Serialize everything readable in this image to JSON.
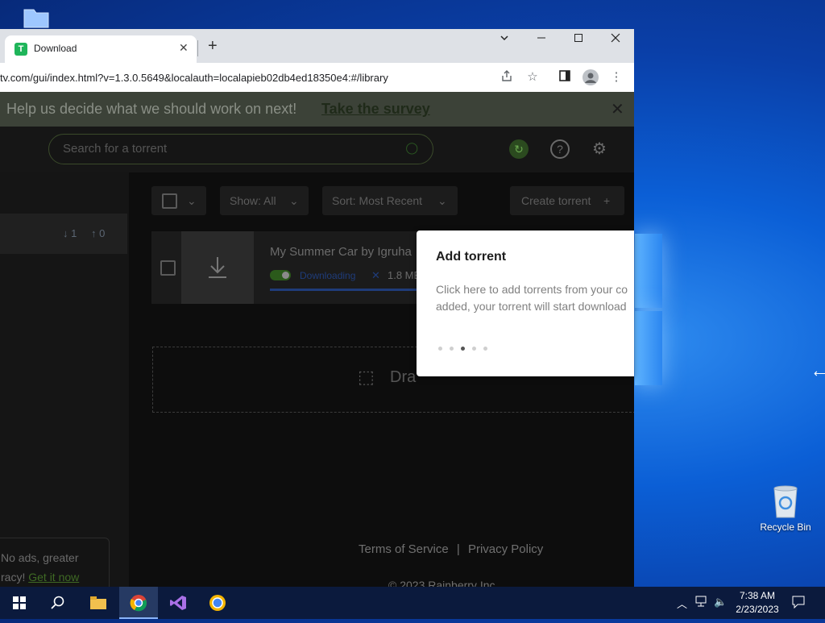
{
  "browser": {
    "tab_title": "Download",
    "tab_favicon": "T",
    "tab_close": "✕",
    "new_tab": "+",
    "url": "tv.com/gui/index.html?v=1.3.0.5649&localauth=localapieb02db4ed18350e4:#/library",
    "window_controls": [
      "chevron-down",
      "minimize",
      "maximize",
      "close"
    ]
  },
  "survey": {
    "message": "Help us decide what we should work on next!",
    "link": "Take the survey",
    "close": "✕"
  },
  "header": {
    "search_placeholder": "Search for a torrent"
  },
  "sidebar": {
    "count_a": "1",
    "count_b": "0",
    "promo_line1": "No ads, greater",
    "promo_line2_prefix": "racy!",
    "promo_link": "Get it now"
  },
  "controls": {
    "show_label": "Show:",
    "show_value": "All",
    "sort_label": "Sort:",
    "sort_value": "Most Recent",
    "create_label": "Create torrent",
    "create_icon": "+"
  },
  "torrent": {
    "name": "My Summer Car by Igruha",
    "status": "Downloading",
    "size": "1.8 MB",
    "progress": 1.0
  },
  "dropzone": {
    "text": "Dra"
  },
  "footer": {
    "terms": "Terms of Service",
    "separator": "|",
    "privacy": "Privacy Policy",
    "copyright": "© 2023 Rainberry Inc."
  },
  "popup": {
    "title": "Add torrent",
    "body_line1": "Click here to add torrents from your co",
    "body_line2": "added, your torrent will start download",
    "steps_total": 5,
    "steps_active": 3
  },
  "desktop": {
    "recycle_bin": "Recycle Bin"
  },
  "taskbar": {
    "time": "7:38 AM",
    "date": "2/23/2023"
  },
  "colors": {
    "accent_green": "#2b5a1b",
    "status_blue": "#1f3c7a",
    "desktop_blue": "#0b5fd6",
    "taskbar": "#0b1a3d"
  }
}
